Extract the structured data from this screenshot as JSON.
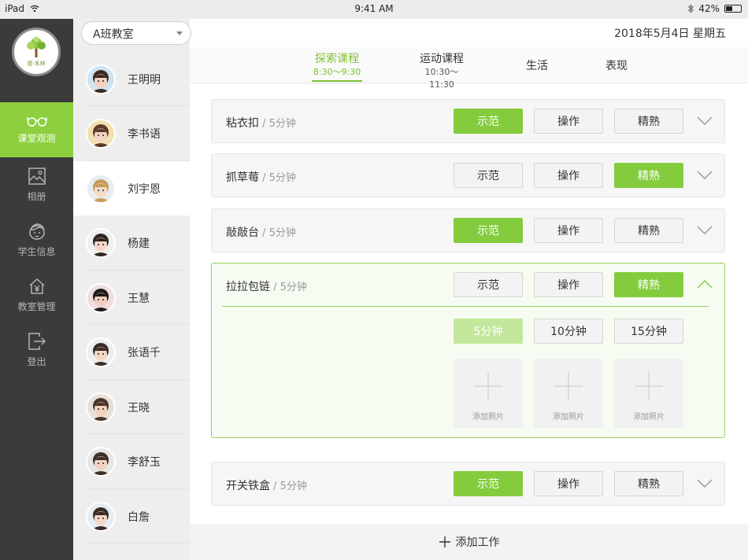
{
  "status": {
    "device": "iPad",
    "time": "9:41 AM",
    "battery": "42%",
    "battery_level": 0.42
  },
  "colors": {
    "accent": "#84cc3e",
    "sidebar": "#3a3b3a"
  },
  "logo": {
    "brand_text": "德·禾林"
  },
  "nav": [
    {
      "label": "课堂观测",
      "icon": "glasses-icon",
      "active": true
    },
    {
      "label": "相册",
      "icon": "image-icon"
    },
    {
      "label": "学生信息",
      "icon": "student-face-icon"
    },
    {
      "label": "教室管理",
      "icon": "house-yen-icon"
    },
    {
      "label": "登出",
      "icon": "logout-icon"
    }
  ],
  "class_selector": {
    "value": "A班教室"
  },
  "students": [
    {
      "name": "王明明"
    },
    {
      "name": "李书语"
    },
    {
      "name": "刘宇恩",
      "active": true
    },
    {
      "name": "杨建"
    },
    {
      "name": "王慧"
    },
    {
      "name": "张语千"
    },
    {
      "name": "王晓"
    },
    {
      "name": "李舒玉"
    },
    {
      "name": "白詹"
    }
  ],
  "date": "2018年5月4日  星期五",
  "tabs": [
    {
      "label": "探索课程",
      "sub": "8:30～9:30",
      "active": true
    },
    {
      "label": "运动课程",
      "sub": "10:30～11:30"
    },
    {
      "label": "生活",
      "sub": ""
    },
    {
      "label": "表现",
      "sub": ""
    }
  ],
  "buttons": {
    "demo": "示范",
    "operate": "操作",
    "proficient": "精熟"
  },
  "works": [
    {
      "name": "粘衣扣",
      "duration": " / 5分钟",
      "selected": "demo"
    },
    {
      "name": "抓草莓",
      "duration": " / 5分钟",
      "selected": "proficient"
    },
    {
      "name": "敲敲台",
      "duration": " / 5分钟",
      "selected": "demo"
    },
    {
      "name": "拉拉包链",
      "duration": " / 5分钟",
      "selected": "proficient",
      "expanded": true
    },
    {
      "name": "开关铁盒",
      "duration": " / 5分钟",
      "selected": "demo"
    }
  ],
  "durations": {
    "options": [
      "5分钟",
      "10分钟",
      "15分钟"
    ],
    "selected": "5分钟"
  },
  "add_photo_label": "添加照片",
  "add_work_label": "添加工作"
}
